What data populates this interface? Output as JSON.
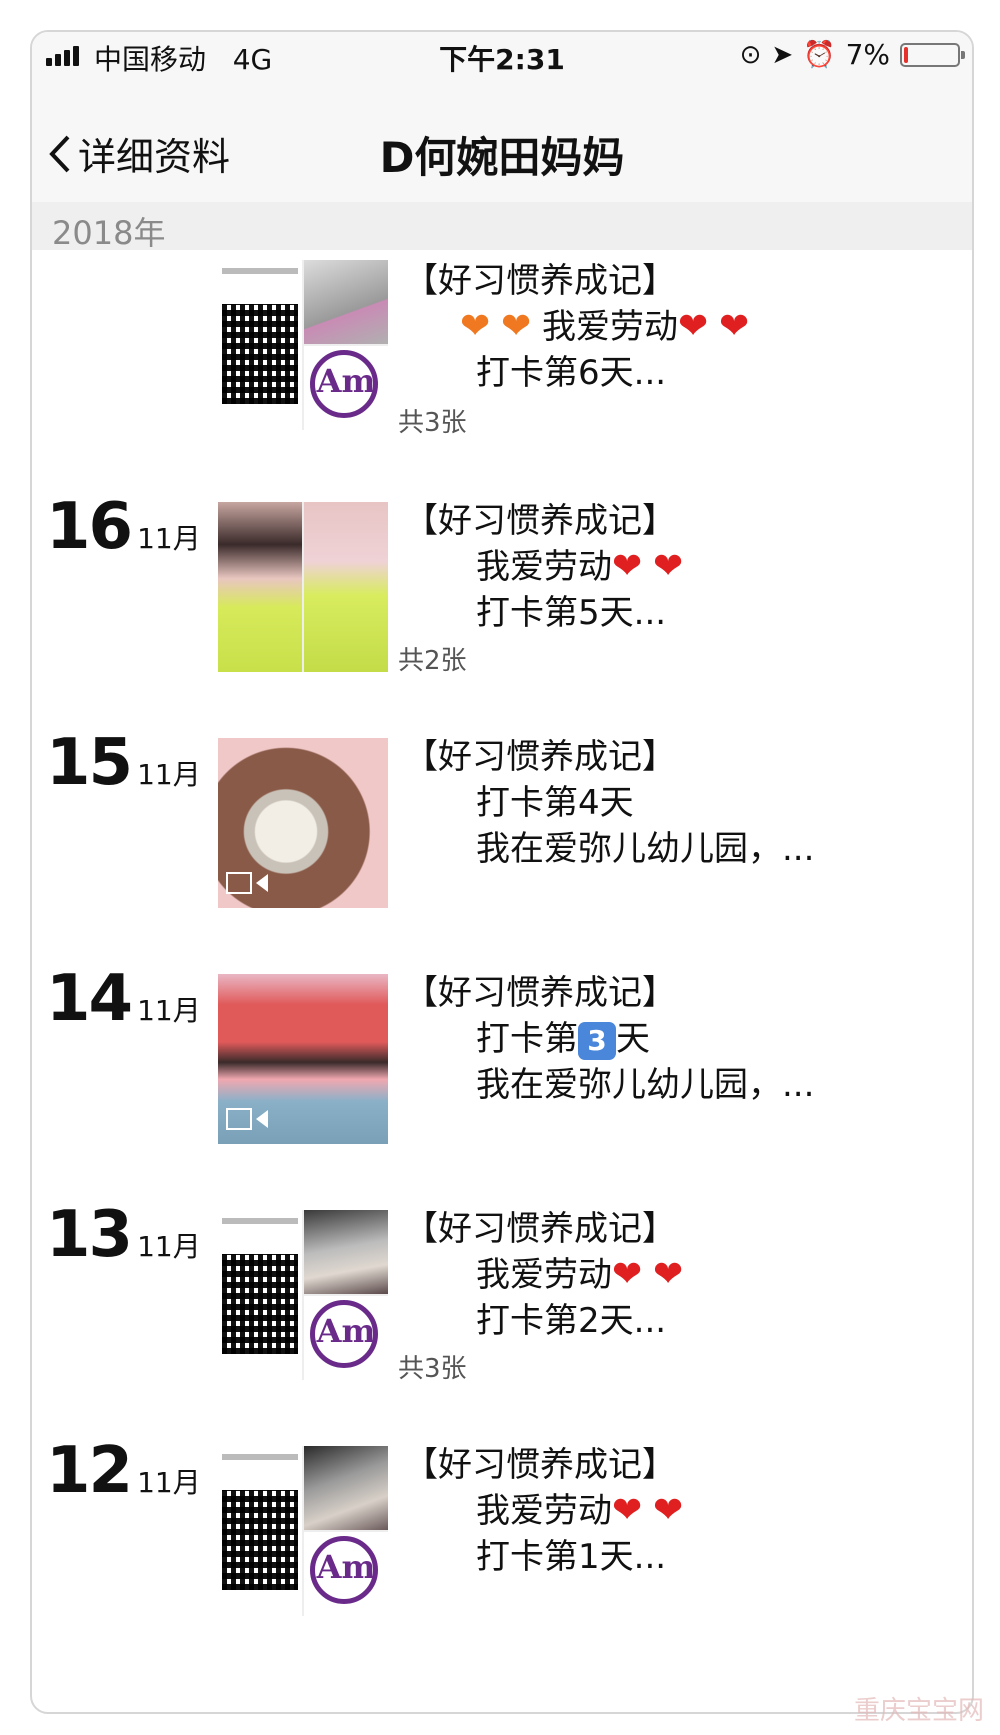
{
  "status": {
    "carrier": "中国移动",
    "network": "4G",
    "time": "下午2:31",
    "battery": "7%",
    "battery_level": 0.07
  },
  "nav": {
    "back_label": "详细资料",
    "title": "D何婉田妈妈"
  },
  "year_header": "2018年",
  "entries": [
    {
      "day": "",
      "month": "",
      "count": "共3张",
      "heading": "【好习惯养成记】",
      "line1": "我爱劳动",
      "line2": "打卡第6天..."
    },
    {
      "day": "16",
      "month": "11月",
      "count": "共2张",
      "heading": "【好习惯养成记】",
      "line1": "我爱劳动",
      "line2": "打卡第5天..."
    },
    {
      "day": "15",
      "month": "11月",
      "heading": "【好习惯养成记】",
      "line1": "打卡第4天",
      "line2": "我在爱弥儿幼儿园，..."
    },
    {
      "day": "14",
      "month": "11月",
      "heading": "【好习惯养成记】",
      "line1_prefix": "打卡第",
      "line1_keycap": "3",
      "line1_suffix": "天",
      "line2": "我在爱弥儿幼儿园，..."
    },
    {
      "day": "13",
      "month": "11月",
      "count": "共3张",
      "heading": "【好习惯养成记】",
      "line1": "我爱劳动",
      "line2": "打卡第2天..."
    },
    {
      "day": "12",
      "month": "11月",
      "heading": "【好习惯养成记】",
      "line1": "我爱劳动",
      "line2": "打卡第1天..."
    }
  ],
  "icons": {
    "heart": "❤",
    "logo_mark": "Am"
  },
  "watermark": "重庆宝宝网",
  "colors": {
    "heart_red": "#e02020",
    "heart_orange": "#f07820",
    "logo_purple": "#6a2a8a",
    "battery_red": "#e5302b"
  }
}
